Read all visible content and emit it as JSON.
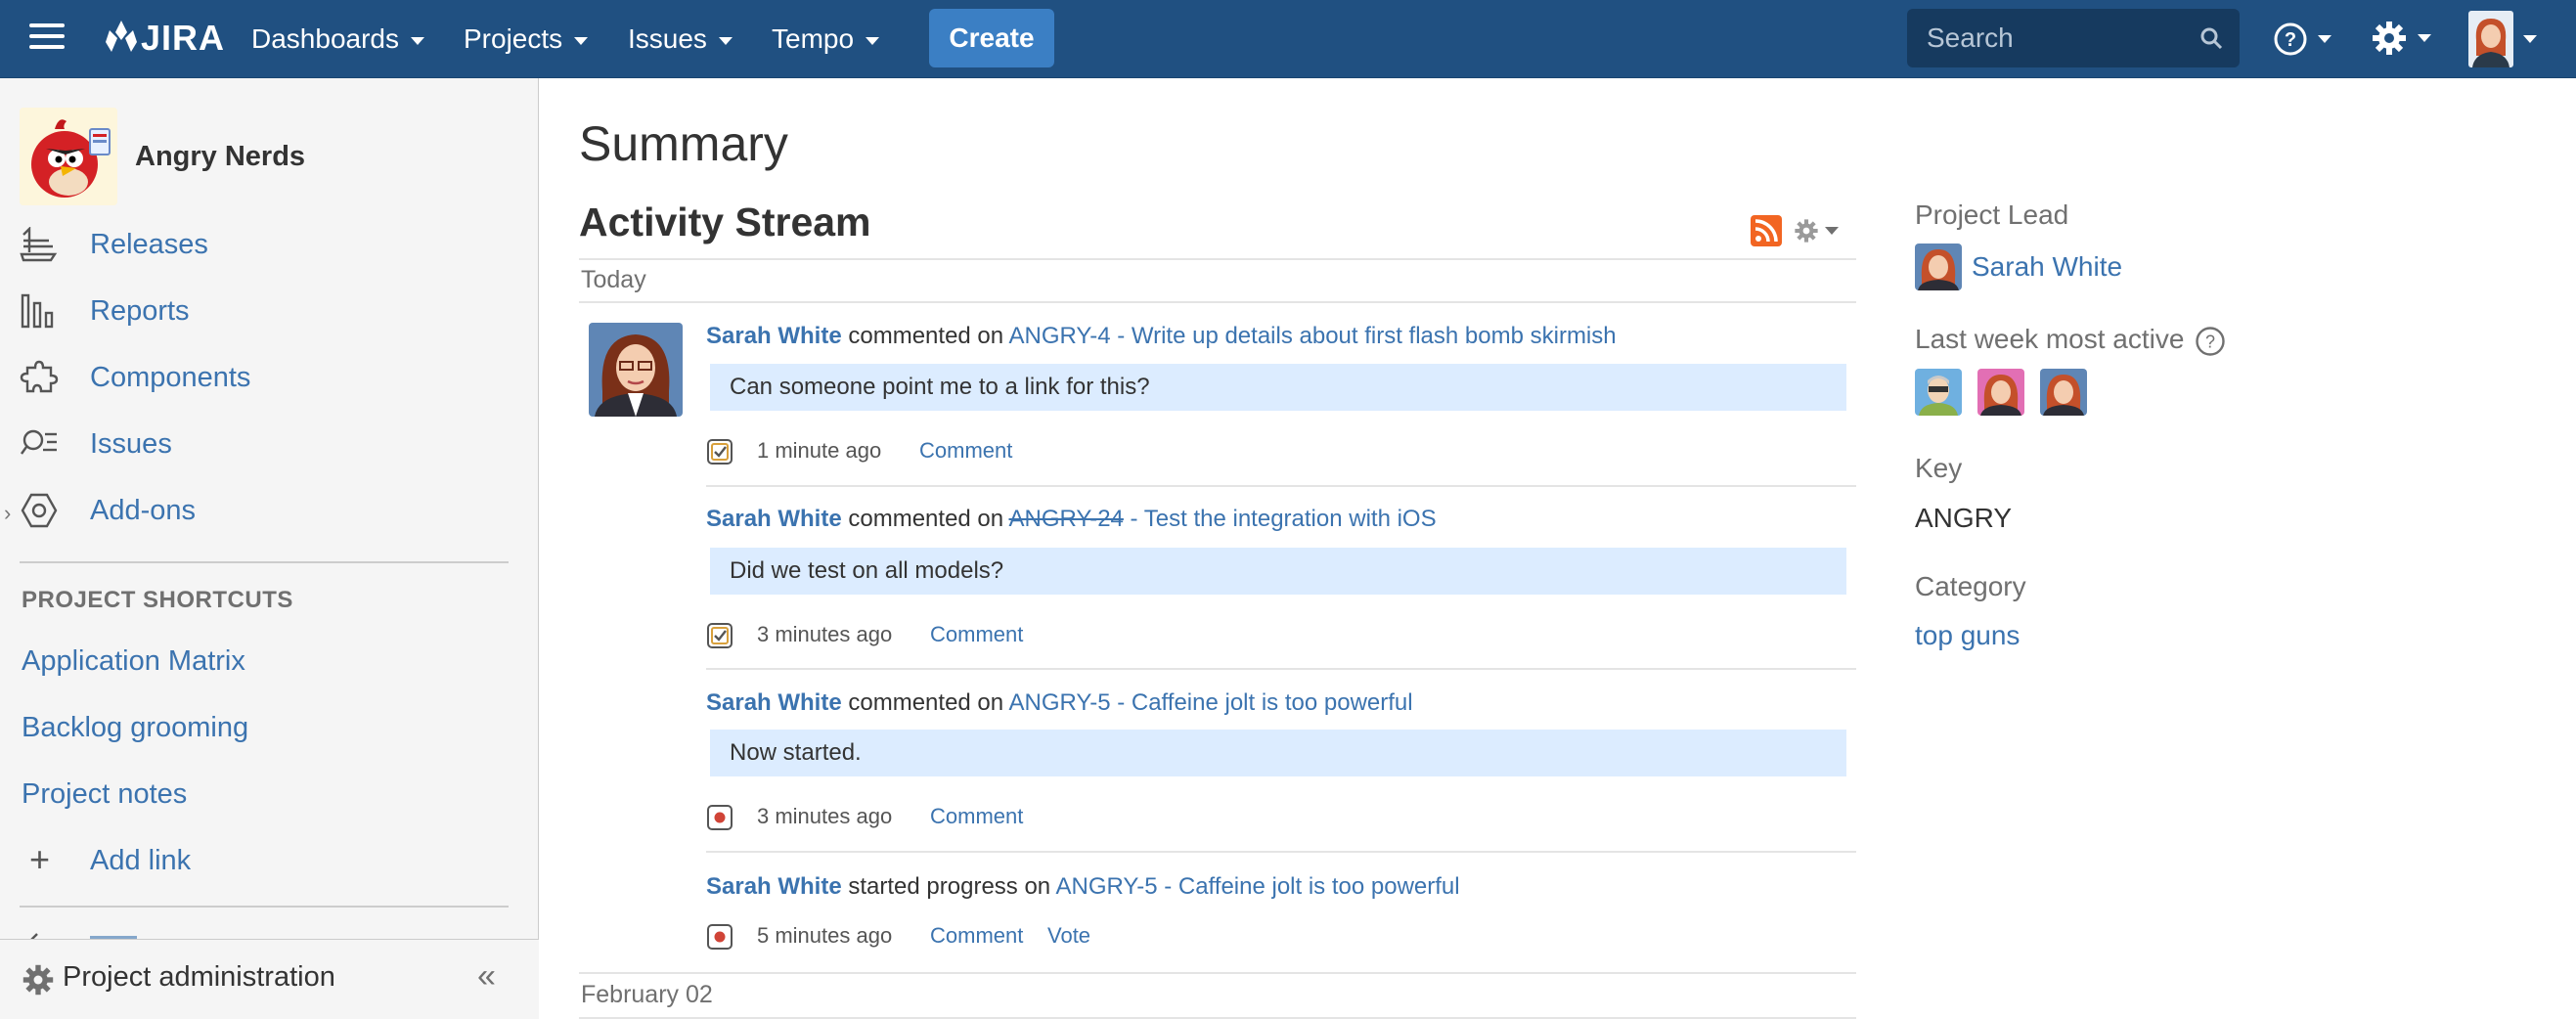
{
  "colors": {
    "header": "#205081",
    "create": "#3b7fc4",
    "link": "#3b73af",
    "quote_bg": "#dcecff",
    "sidebar_bg": "#f5f5f5"
  },
  "header": {
    "logo_text": "JIRA",
    "nav": [
      "Dashboards",
      "Projects",
      "Issues",
      "Tempo"
    ],
    "create_label": "Create",
    "search_placeholder": "Search"
  },
  "sidebar": {
    "project_name": "Angry Nerds",
    "items": [
      {
        "label": "Releases",
        "icon": "releases-icon"
      },
      {
        "label": "Reports",
        "icon": "reports-icon"
      },
      {
        "label": "Components",
        "icon": "components-icon"
      },
      {
        "label": "Issues",
        "icon": "issues-icon"
      },
      {
        "label": "Add-ons",
        "icon": "add-ons-icon"
      }
    ],
    "shortcuts_title": "PROJECT SHORTCUTS",
    "shortcuts": [
      "Application Matrix",
      "Backlog grooming",
      "Project notes"
    ],
    "add_link_label": "Add link",
    "admin_label": "Project administration"
  },
  "main": {
    "title": "Summary",
    "stream_title": "Activity Stream",
    "day_today": "Today",
    "day_earlier": "February 02",
    "entries": [
      {
        "who": "Sarah White",
        "verb": "commented on",
        "issue": "ANGRY-4 - Write up details about first flash bomb skirmish",
        "comment": "Can someone point me to a link for this?",
        "time": "1 minute ago",
        "action": "Comment",
        "type_icon": "task-icon"
      },
      {
        "who": "Sarah White",
        "verb": "commented on",
        "issue_key": "ANGRY-24",
        "issue_rest": " - Test the integration with iOS",
        "comment": "Did we test on all models?",
        "time": "3 minutes ago",
        "action": "Comment",
        "type_icon": "task-icon"
      },
      {
        "who": "Sarah White",
        "verb": "commented on",
        "issue": "ANGRY-5 - Caffeine jolt is too powerful",
        "comment": "Now started.",
        "time": "3 minutes ago",
        "action": "Comment",
        "type_icon": "bug-icon"
      },
      {
        "who": "Sarah White",
        "verb": "started progress on",
        "issue": "ANGRY-5 - Caffeine jolt is too powerful",
        "time": "5 minutes ago",
        "action": "Comment",
        "action2": "Vote",
        "type_icon": "bug-icon"
      }
    ]
  },
  "right_panel": {
    "lead_label": "Project Lead",
    "lead_name": "Sarah White",
    "active_label": "Last week most active",
    "key_label": "Key",
    "key_value": "ANGRY",
    "category_label": "Category",
    "category_value": "top guns"
  }
}
